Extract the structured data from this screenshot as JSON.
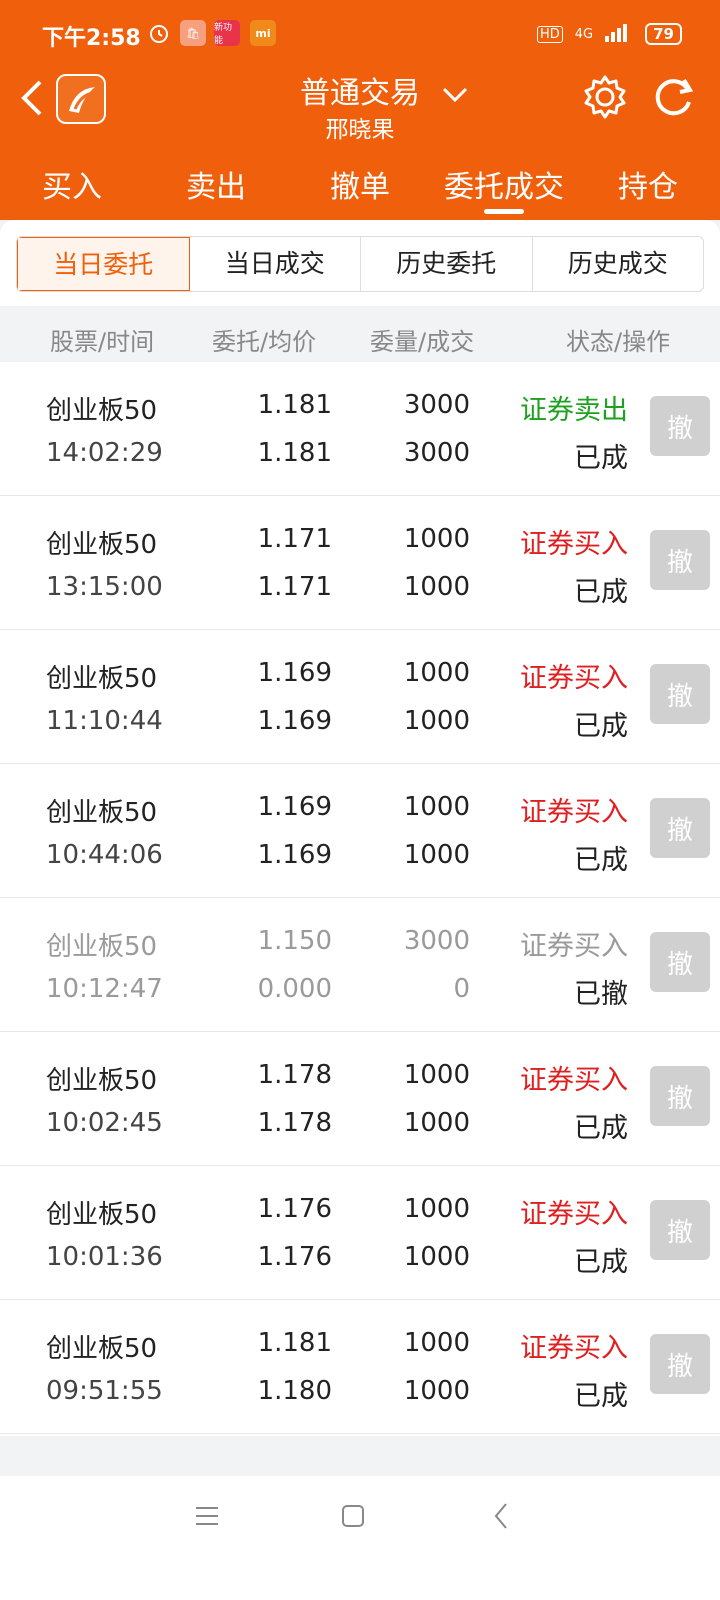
{
  "status_bar": {
    "time": "下午2:58",
    "network": "4G",
    "battery": "79",
    "hd": "HD",
    "app_icon_label": "新功能"
  },
  "header": {
    "title": "普通交易",
    "subtitle": "邢晓果"
  },
  "tabs": [
    "买入",
    "卖出",
    "撤单",
    "委托成交",
    "持仓"
  ],
  "segments": [
    "当日委托",
    "当日成交",
    "历史委托",
    "历史成交"
  ],
  "columns": [
    "股票/时间",
    "委托/均价",
    "委量/成交",
    "状态/操作"
  ],
  "cancel_label": "撤",
  "orders": [
    {
      "name": "创业板50",
      "time": "14:02:29",
      "order_price": "1.181",
      "avg_price": "1.181",
      "order_qty": "3000",
      "filled_qty": "3000",
      "type": "证券卖出",
      "status": "已成"
    },
    {
      "name": "创业板50",
      "time": "13:15:00",
      "order_price": "1.171",
      "avg_price": "1.171",
      "order_qty": "1000",
      "filled_qty": "1000",
      "type": "证券买入",
      "status": "已成"
    },
    {
      "name": "创业板50",
      "time": "11:10:44",
      "order_price": "1.169",
      "avg_price": "1.169",
      "order_qty": "1000",
      "filled_qty": "1000",
      "type": "证券买入",
      "status": "已成"
    },
    {
      "name": "创业板50",
      "time": "10:44:06",
      "order_price": "1.169",
      "avg_price": "1.169",
      "order_qty": "1000",
      "filled_qty": "1000",
      "type": "证券买入",
      "status": "已成"
    },
    {
      "name": "创业板50",
      "time": "10:12:47",
      "order_price": "1.150",
      "avg_price": "0.000",
      "order_qty": "3000",
      "filled_qty": "0",
      "type": "证券买入",
      "status": "已撤"
    },
    {
      "name": "创业板50",
      "time": "10:02:45",
      "order_price": "1.178",
      "avg_price": "1.178",
      "order_qty": "1000",
      "filled_qty": "1000",
      "type": "证券买入",
      "status": "已成"
    },
    {
      "name": "创业板50",
      "time": "10:01:36",
      "order_price": "1.176",
      "avg_price": "1.176",
      "order_qty": "1000",
      "filled_qty": "1000",
      "type": "证券买入",
      "status": "已成"
    },
    {
      "name": "创业板50",
      "time": "09:51:55",
      "order_price": "1.181",
      "avg_price": "1.180",
      "order_qty": "1000",
      "filled_qty": "1000",
      "type": "证券买入",
      "status": "已成"
    }
  ],
  "colors": {
    "accent": "#f0600c",
    "buy": "#e02020",
    "sell": "#20a020"
  }
}
